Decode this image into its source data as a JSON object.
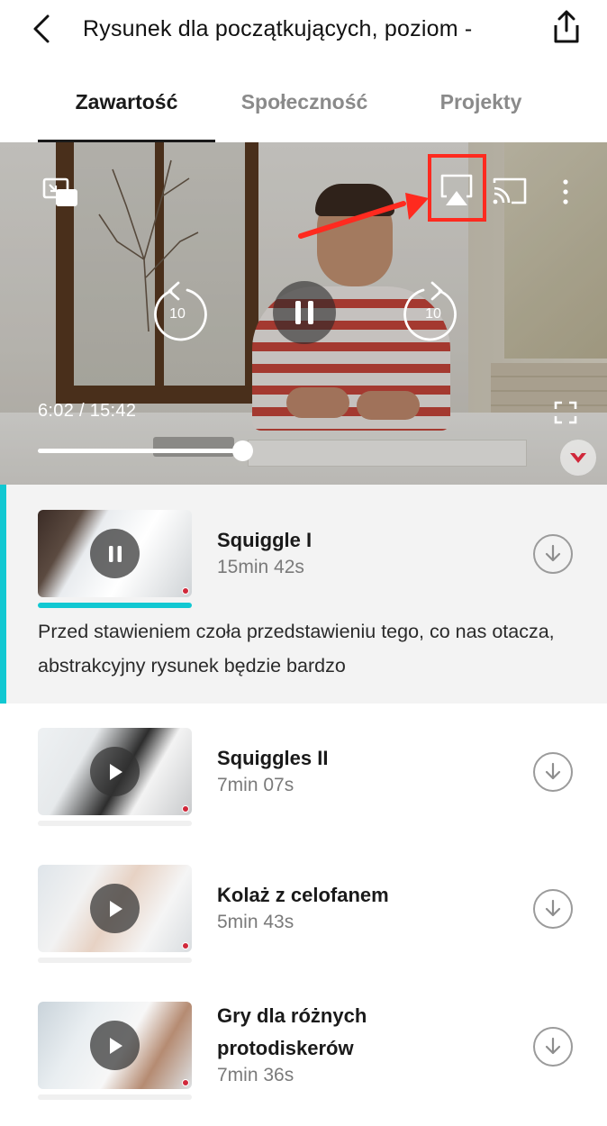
{
  "header": {
    "title": "Rysunek dla początkujących, poziom -",
    "back_icon": "chevron-left-icon",
    "share_icon": "share-icon"
  },
  "tabs": [
    {
      "label": "Zawartość",
      "active": true
    },
    {
      "label": "Społeczność",
      "active": false
    },
    {
      "label": "Projekty",
      "active": false
    }
  ],
  "player": {
    "current_time": "6:02 / 15:42",
    "progress_fraction": 0.384,
    "rewind_seconds": "10",
    "forward_seconds": "10",
    "icons": [
      "picture-in-picture-icon",
      "airplay-icon",
      "cast-icon",
      "more-vertical-icon",
      "rewind-10-icon",
      "pause-icon",
      "forward-10-icon",
      "fullscreen-icon",
      "brand-logo-icon"
    ],
    "highlight_color": "#ff2a1f"
  },
  "lessons": [
    {
      "title": "Squiggle I",
      "duration": "15min 42s",
      "state": "playing",
      "description": "Przed stawieniem czoła przedstawieniu tego, co nas otacza, abstrakcyjny rysunek będzie bardzo"
    },
    {
      "title": "Squiggles II",
      "duration": "7min 07s",
      "state": "paused"
    },
    {
      "title": "Kolaż z celofanem",
      "duration": "5min 43s",
      "state": "paused"
    },
    {
      "title": "Gry dla różnych protodiskerów",
      "duration": "7min 36s",
      "state": "paused"
    }
  ],
  "colors": {
    "accent": "#11c8d2",
    "active_row_bg": "#f3f3f3",
    "text_primary": "#1a1a1a",
    "text_secondary": "#7a7a7a"
  }
}
